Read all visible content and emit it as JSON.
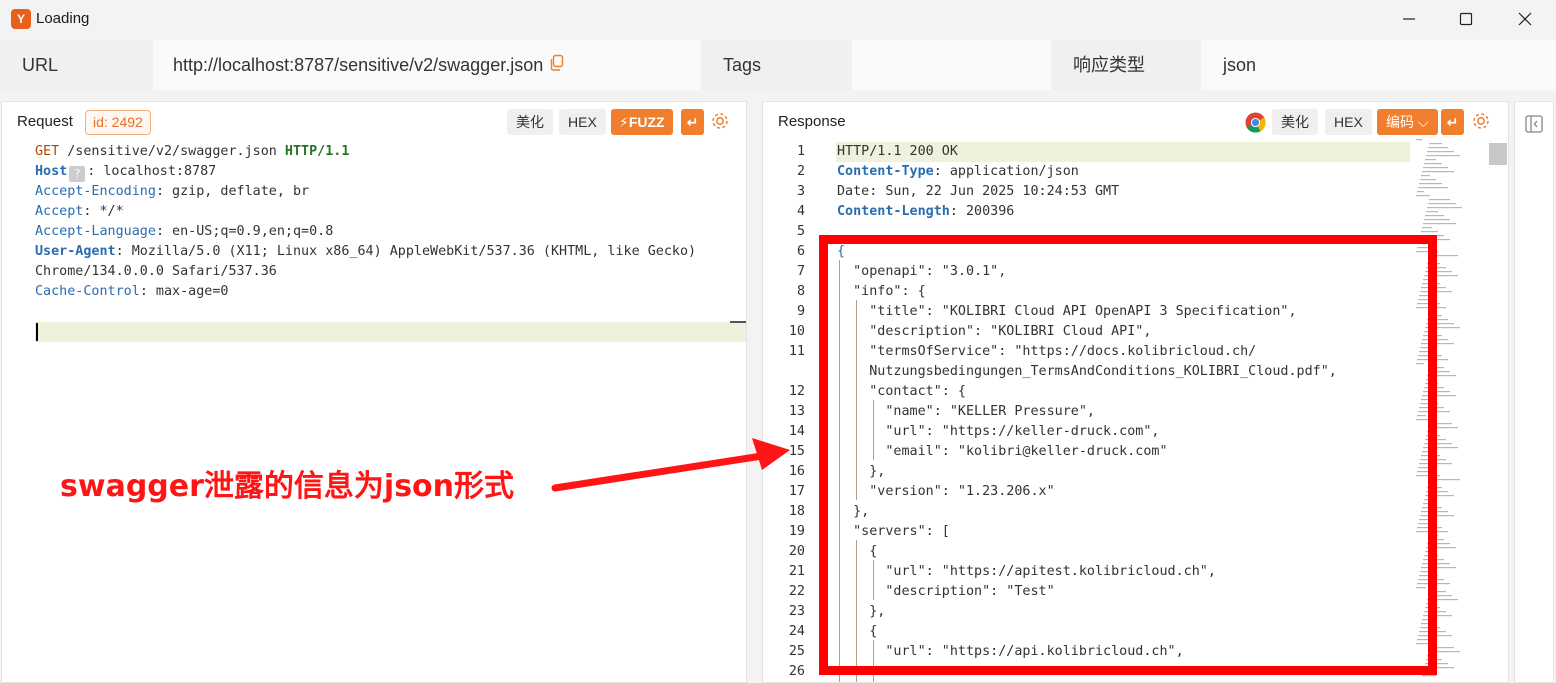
{
  "window": {
    "title": "Loading",
    "logo": "Y"
  },
  "infobar": {
    "url_label": "URL",
    "url_value": "http://localhost:8787/sensitive/v2/swagger.json",
    "tags_label": "Tags",
    "tags_value": "",
    "resp_type_label": "响应类型",
    "resp_type_value": "json"
  },
  "request": {
    "title": "Request",
    "id_badge": "id: 2492",
    "btn_beautify": "美化",
    "btn_hex": "HEX",
    "btn_fuzz": "FUZZ",
    "lines": [
      {
        "a": "GET",
        "b": " /sensitive/v2/swagger.json ",
        "c": "HTTP/1.1"
      },
      {
        "a": "Host",
        "b": ": localhost:8787"
      },
      {
        "a": "Accept-Encoding",
        "b": ": gzip, deflate, br"
      },
      {
        "a": "Accept",
        "b": ": */*"
      },
      {
        "a": "Accept-Language",
        "b": ": en-US;q=0.9,en;q=0.8"
      },
      {
        "a": "User-Agent",
        "b": ": Mozilla/5.0 (X11; Linux x86_64) AppleWebKit/537.36 (KHTML, like Gecko)"
      },
      {
        "a": "",
        "b": "Chrome/134.0.0.0 Safari/537.36"
      },
      {
        "a": "Cache-Control",
        "b": ": max-age=0"
      }
    ]
  },
  "response": {
    "title": "Response",
    "btn_beautify": "美化",
    "btn_hex": "HEX",
    "btn_encode": "编码",
    "status_line": "HTTP/1.1 200 OK",
    "headers": [
      {
        "k": "Content-Type",
        "v": ": application/json"
      },
      {
        "k": "Date",
        "v": ": Sun, 22 Jun 2025 10:24:53 GMT"
      },
      {
        "k": "Content-Length",
        "v": ": 200396"
      }
    ],
    "body": [
      "{",
      "  \"openapi\": \"3.0.1\",",
      "  \"info\": {",
      "    \"title\": \"KOLIBRI Cloud API OpenAPI 3 Specification\",",
      "    \"description\": \"KOLIBRI Cloud API\",",
      "    \"termsOfService\": \"https://docs.kolibricloud.ch/",
      "    Nutzungsbedingungen_TermsAndConditions_KOLIBRI_Cloud.pdf\",",
      "    \"contact\": {",
      "      \"name\": \"KELLER Pressure\",",
      "      \"url\": \"https://keller-druck.com\",",
      "      \"email\": \"kolibri@keller-druck.com\"",
      "    },",
      "    \"version\": \"1.23.206.x\"",
      "  },",
      "  \"servers\": [",
      "    {",
      "      \"url\": \"https://apitest.kolibricloud.ch\",",
      "      \"description\": \"Test\"",
      "    },",
      "    {",
      "      \"url\": \"https://api.kolibricloud.ch\","
    ],
    "line_numbers": [
      "1",
      "2",
      "3",
      "4",
      "5",
      "6",
      "7",
      "8",
      "9",
      "10",
      "11",
      "",
      "12",
      "13",
      "14",
      "15",
      "16",
      "17",
      "18",
      "19",
      "20",
      "21",
      "22",
      "23",
      "24",
      "25",
      "26"
    ]
  },
  "annotation": "swagger泄露的信息为json形式",
  "colors": {
    "accent": "#f07e2c",
    "annotation": "#ff0000"
  }
}
